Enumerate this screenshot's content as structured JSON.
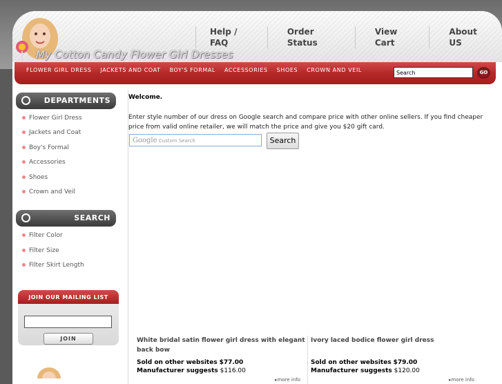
{
  "brand": {
    "site_name": "My Cotton Candy Flower Girl Dresses"
  },
  "top_links": [
    "Help / FAQ",
    "Order Status",
    "View Cart",
    "About US"
  ],
  "nav": {
    "items": [
      "FLOWER GIRL DRESS",
      "JACKETS AND COAT",
      "BOY'S FORMAL",
      "ACCESSORIES",
      "SHOES",
      "CROWN AND VEIL"
    ],
    "search_value": "Search",
    "go_label": "GO"
  },
  "sidebar": {
    "departments_title": "DEPARTMENTS",
    "departments": [
      "Flower Girl Dress",
      "Jackets and Coat",
      "Boy's Formal",
      "Accessories",
      "Shoes",
      "Crown and Veil"
    ],
    "search_title": "SEARCH",
    "search_items": [
      "Filter Color",
      "Filter Size",
      "Filter Skirt Length"
    ],
    "mailing_title": "JOIN OUR MAILING LIST",
    "join_label": "JOIN"
  },
  "main": {
    "welcome": "Welcome.",
    "intro": "Enter style number of our dress on Google search and compare price with other online sellers. If you find cheaper price from valid online retailer, we will match the price and give you $20 gift card.",
    "google_brand": "Google",
    "google_placeholder": "Custom Search",
    "search_button": "Search"
  },
  "products": [
    {
      "title": "White bridal satin flower girl dress with elegant back bow",
      "other_label": "Sold on other websites",
      "other_price": "$77.00",
      "msrp_label": "Manufacturer suggests",
      "msrp_price": "$116.00",
      "more_info": "more info"
    },
    {
      "title": "Ivory laced bodice flower girl dress",
      "other_label": "Sold on other websites",
      "other_price": "$79.00",
      "msrp_label": "Manufacturer suggests",
      "msrp_price": "$120.00",
      "more_info": "more info"
    }
  ]
}
